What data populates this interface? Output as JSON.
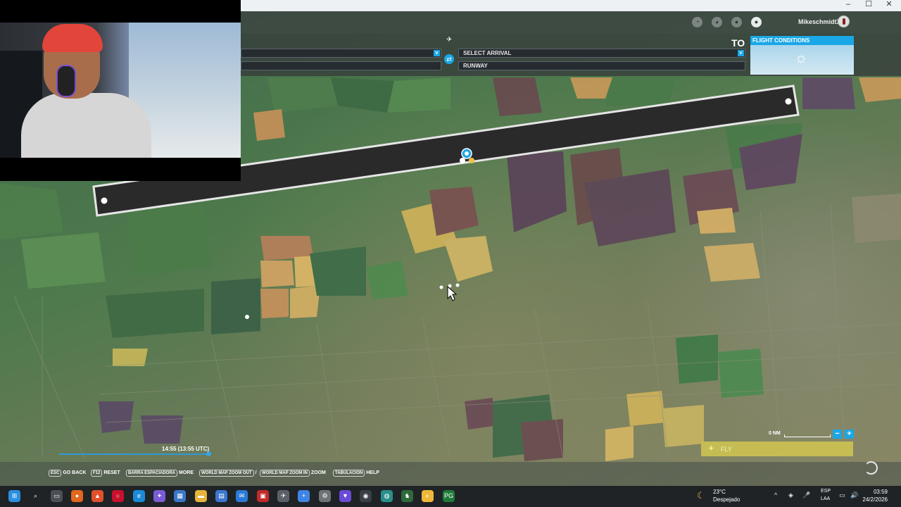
{
  "window": {
    "controls": [
      "–",
      "☐",
      "✕"
    ]
  },
  "header": {
    "username": "MikeschmidtX",
    "icons": [
      "marketplace-icon",
      "navlog-icon",
      "profile-icon",
      "notifications-icon"
    ]
  },
  "planner": {
    "departure_value": "",
    "swap_glyph": "⇄",
    "plane_glyph": "✈",
    "to_label": "TO",
    "arrival_placeholder": "SELECT ARRIVAL",
    "runway_label": "RUNWAY",
    "caret_glyph": "v"
  },
  "conditions": {
    "title": "FLIGHT CONDITIONS",
    "weather_icon": "☼"
  },
  "route": {
    "waypoint_color": "#ffffff",
    "ribbon_color": "#2a2a2a"
  },
  "time": {
    "label": "14:55 (13:55 UTC)",
    "progress": 0.6
  },
  "scale": {
    "label": "0 NM"
  },
  "zoom": {
    "minus": "−",
    "plus": "+"
  },
  "fly": {
    "icon": "✈",
    "label": "FLY"
  },
  "hints": [
    {
      "key": "ESC",
      "label": "GO BACK"
    },
    {
      "key": "F12",
      "label": "RESET"
    },
    {
      "key": "BARRA ESPACIADORA",
      "label": "MORE"
    },
    {
      "key": "WORLD MAP ZOOM OUT",
      "label": "/"
    },
    {
      "key": "WORLD MAP ZOOM IN",
      "label": "ZOOM"
    },
    {
      "key": "TABULACION",
      "label": "HELP"
    }
  ],
  "taskbar": {
    "weather_icon": "☾",
    "temperature": "23°C",
    "condition": "Despejado",
    "lang1": "ESP",
    "lang2": "LAA",
    "time": "03:59",
    "date": "24/2/2026",
    "tray": [
      "^",
      "◈",
      "🎤",
      "▭",
      "🔊"
    ]
  },
  "colors": {
    "accent": "#1aa7e6",
    "fly_button": "#c5bd53"
  }
}
